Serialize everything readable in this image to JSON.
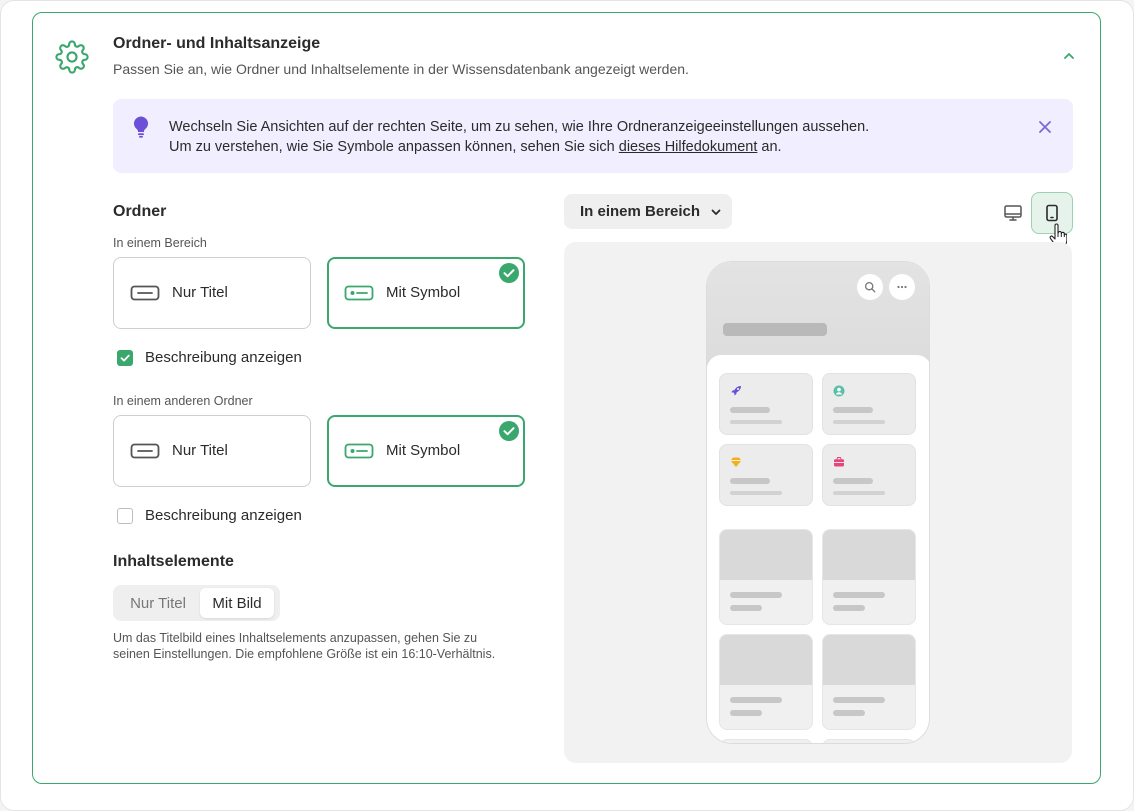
{
  "header": {
    "title": "Ordner- und Inhaltsanzeige",
    "description": "Passen Sie an, wie Ordner und Inhaltselemente in der Wissensdatenbank angezeigt werden."
  },
  "info": {
    "line1": "Wechseln Sie Ansichten auf der rechten Seite, um zu sehen, wie Ihre Ordneranzeigeeinstellungen aussehen.",
    "line2_prefix": "Um zu verstehen, wie Sie Symbole anpassen können, sehen Sie sich ",
    "link": "dieses Hilfedokument",
    "line2_suffix": " an."
  },
  "folders": {
    "title": "Ordner",
    "group1": {
      "label": "In einem Bereich",
      "option_title": "Nur Titel",
      "option_symbol": "Mit Symbol",
      "selected": "Mit Symbol",
      "show_description": "Beschreibung anzeigen",
      "show_description_checked": true
    },
    "group2": {
      "label": "In einem anderen Ordner",
      "option_title": "Nur Titel",
      "option_symbol": "Mit Symbol",
      "selected": "Mit Symbol",
      "show_description": "Beschreibung anzeigen",
      "show_description_checked": false
    }
  },
  "content": {
    "title": "Inhaltselemente",
    "seg_title": "Nur Titel",
    "seg_image": "Mit Bild",
    "selected": "Mit Bild",
    "hint": "Um das Titelbild eines Inhaltselements anzupassen, gehen Sie zu seinen Einstellungen. Die empfohlene Größe ist ein 16:10-Verhältnis."
  },
  "preview": {
    "dropdown_value": "In einem Bereich",
    "active_device": "mobile",
    "folder_icons": [
      "rocket-icon",
      "user-circle-icon",
      "diamond-icon",
      "briefcase-icon"
    ]
  },
  "colors": {
    "accent": "#3aa76d",
    "banner_bg": "#f1efff",
    "bulb": "#6b4fd8",
    "rocket": "#6b4fd8",
    "user": "#5bbfa8",
    "diamond": "#f2b01e",
    "briefcase": "#e4467a"
  }
}
